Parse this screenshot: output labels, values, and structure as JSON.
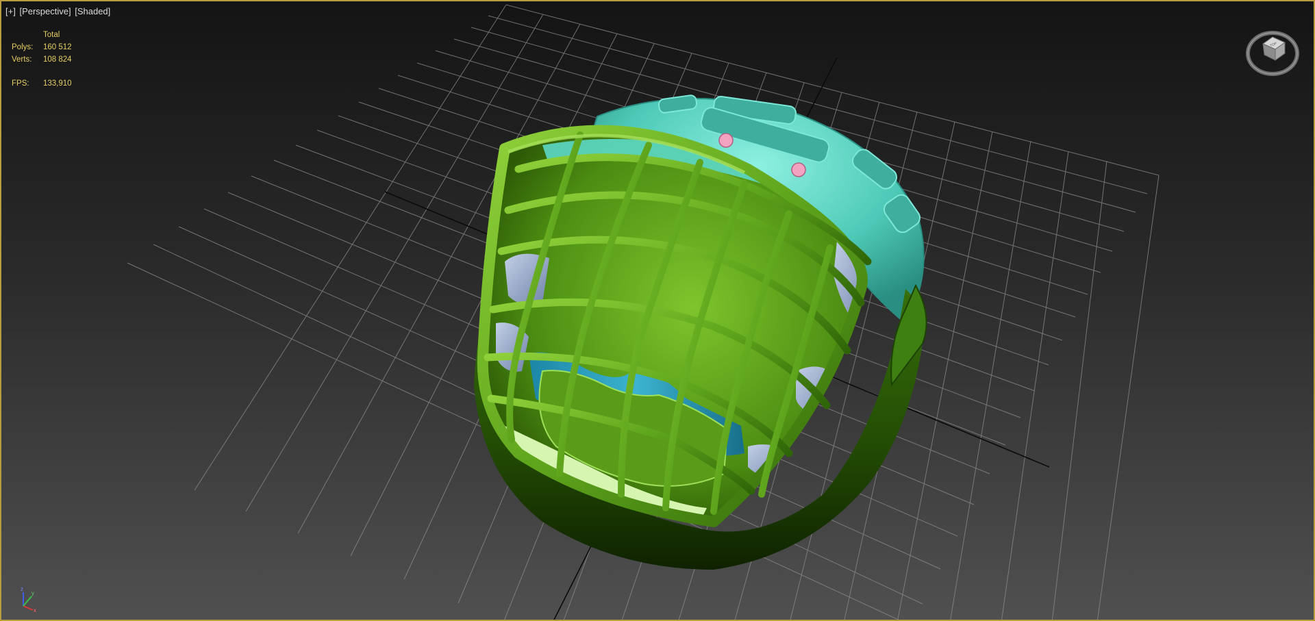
{
  "viewport": {
    "menu_label": "[+]",
    "view_label": "[Perspective]",
    "shading_label": "[Shaded]"
  },
  "stats": {
    "header": "Total",
    "polys_label": "Polys:",
    "polys_value": "160 512",
    "verts_label": "Verts:",
    "verts_value": "108 824",
    "fps_label": "FPS:",
    "fps_value": "133,910"
  },
  "viewcube": {
    "face_label": "TOP"
  },
  "axis_gizmo": {
    "x": "x",
    "y": "y",
    "z": "z"
  },
  "colors": {
    "border": "#b89b3e",
    "stats_text": "#e6cf63",
    "cage_green": "#5fa51c",
    "shell_teal": "#5cd8c6",
    "pad_blue": "#8fa4c8",
    "chin_blue": "#1f8fb0"
  }
}
